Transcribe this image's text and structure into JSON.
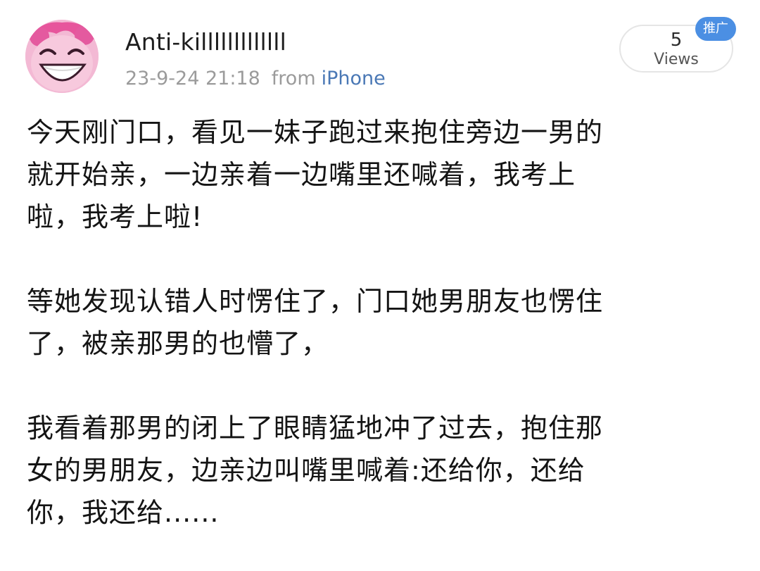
{
  "post": {
    "username": "Anti-killlllllllllll",
    "timestamp": "23-9-24 21:18",
    "from_label": "from",
    "source": "iPhone",
    "views": {
      "count": "5",
      "label": "Views"
    },
    "promo_tag": "推广",
    "paragraphs": [
      {
        "lines": [
          "今天刚门口，看见一妹子跑过来抱住旁边一男的",
          "就开始亲，一边亲着一边嘴里还喊着，我考上",
          "啦，我考上啦!"
        ]
      },
      {
        "lines": [
          "等她发现认错人时愣住了，门口她男朋友也愣住",
          "了，被亲那男的也懵了，"
        ]
      },
      {
        "lines": [
          "我看着那男的闭上了眼睛猛地冲了过去，抱住那",
          "女的男朋友，边亲边叫嘴里喊着:还给你，还给",
          "你，我还给......"
        ]
      }
    ]
  },
  "colors": {
    "source_link": "#4a78b5",
    "promo_tag_bg": "#4b8fe3",
    "meta_text": "#9b9b9b"
  },
  "icons": {
    "avatar": "pink-cartoon-avatar"
  }
}
